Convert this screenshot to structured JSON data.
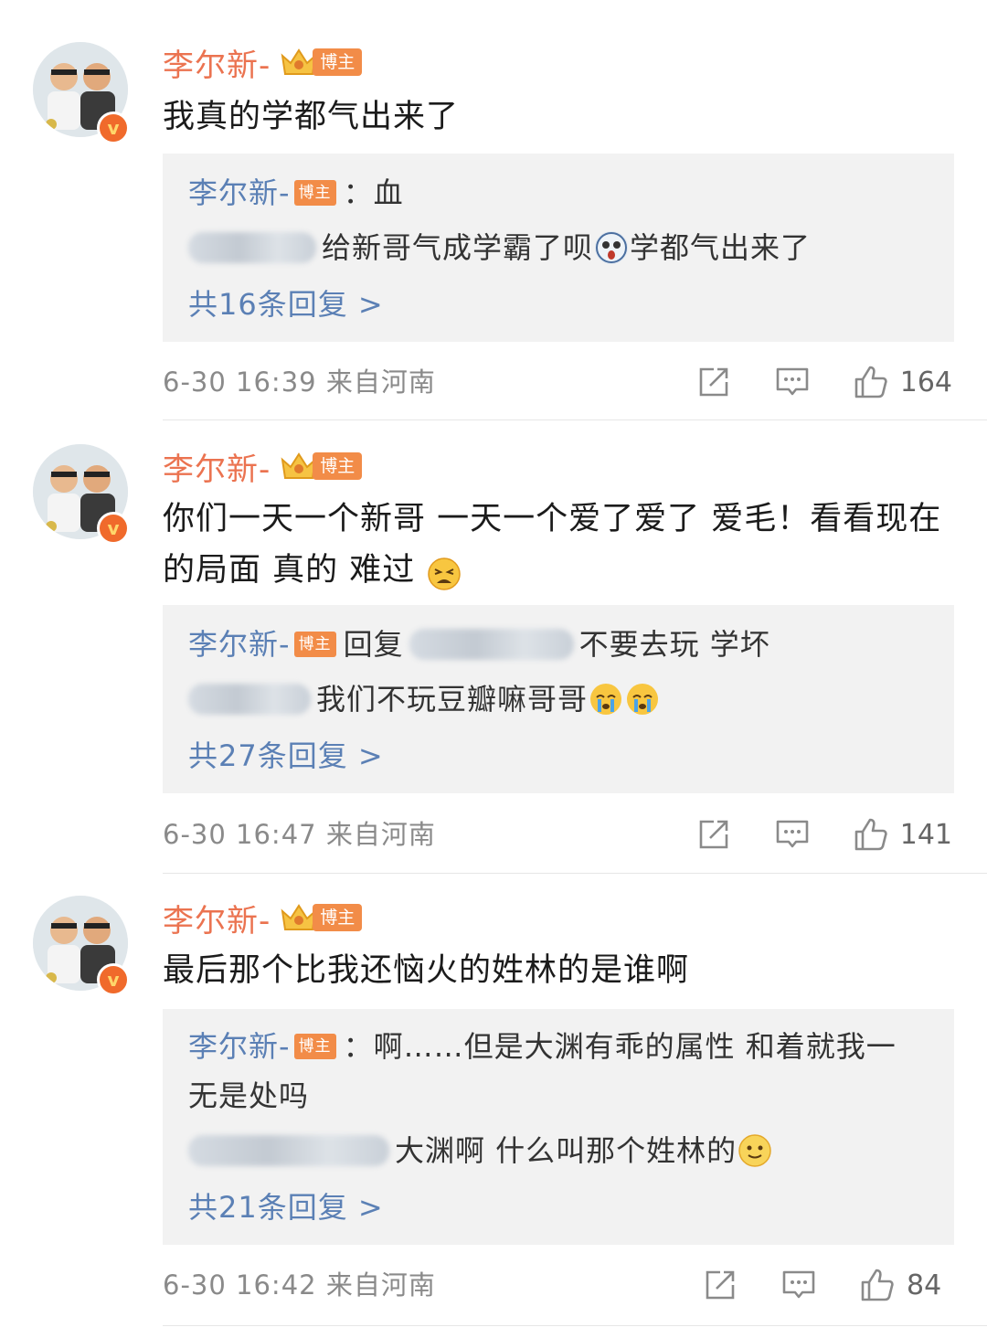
{
  "comments": [
    {
      "author": "李尔新-",
      "badge": "博主",
      "text": "我真的学都气出来了",
      "replies": [
        {
          "author": "李尔新-",
          "badge": "博主",
          "text": "：血"
        },
        {
          "text": "给新哥气成学霸了呗",
          "emoji": "scared-face-emoji",
          "text_after": "学都气出来了"
        }
      ],
      "more": "共16条回复 >",
      "timestamp": "6-30 16:39",
      "location": "来自河南",
      "likes": "164"
    },
    {
      "author": "李尔新-",
      "badge": "博主",
      "text": "你们一天一个新哥 一天一个爱了爱了 爱毛！看看现在的局面 真的 难过",
      "emoji": "tired-face-emoji",
      "replies": [
        {
          "author": "李尔新-",
          "badge": "博主",
          "text_before": "回复",
          "text": "不要去玩 学坏"
        },
        {
          "text": "我们不玩豆瓣嘛哥哥",
          "emoji": "crying-face-emoji"
        }
      ],
      "more": "共27条回复 >",
      "timestamp": "6-30 16:47",
      "location": "来自河南",
      "likes": "141"
    },
    {
      "author": "李尔新-",
      "badge": "博主",
      "text": "最后那个比我还恼火的姓林的是谁啊",
      "replies": [
        {
          "author": "李尔新-",
          "badge": "博主",
          "text": "：啊……但是大渊有乖的属性 和着就我一",
          "text_cont": "无是处吗"
        },
        {
          "text": "大渊啊 什么叫那个姓林的",
          "emoji": "smile-face-emoji"
        }
      ],
      "more": "共21条回复 >",
      "timestamp": "6-30 16:42",
      "location": "来自河南",
      "likes": "84"
    }
  ],
  "icons": {
    "share": "share-icon",
    "comment": "comment-icon",
    "like": "like-icon",
    "verified": "verified-icon",
    "crown": "crown-icon"
  },
  "colors": {
    "author_name": "#eb7350",
    "reply_name": "#5b80b5",
    "badge_bg": "#f28c48",
    "reply_bg": "#f2f2f2"
  }
}
